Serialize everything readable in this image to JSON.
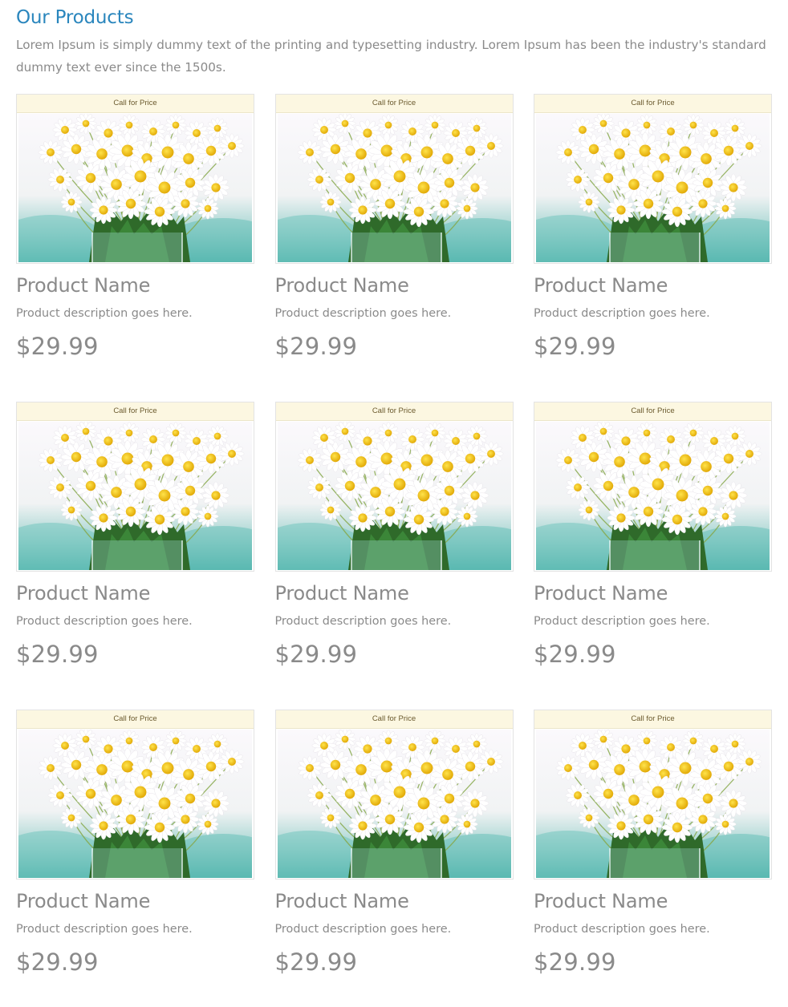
{
  "header": {
    "title": "Our Products",
    "intro": "Lorem Ipsum is simply dummy text of the printing and typesetting industry. Lorem Ipsum has been the industry's standard dummy text ever since the 1500s."
  },
  "colors": {
    "title": "#2a86bd",
    "text": "#8a8a8a",
    "banner_bg": "#fcf7e1"
  },
  "products": [
    {
      "banner": "Call for Price",
      "image": "daisy-bouquet-photo",
      "name": "Product Name",
      "description": "Product description goes here.",
      "price": "$29.99"
    },
    {
      "banner": "Call for Price",
      "image": "daisy-bouquet-photo",
      "name": "Product Name",
      "description": "Product description goes here.",
      "price": "$29.99"
    },
    {
      "banner": "Call for Price",
      "image": "daisy-bouquet-photo",
      "name": "Product Name",
      "description": "Product description goes here.",
      "price": "$29.99"
    },
    {
      "banner": "Call for Price",
      "image": "daisy-bouquet-photo",
      "name": "Product Name",
      "description": "Product description goes here.",
      "price": "$29.99"
    },
    {
      "banner": "Call for Price",
      "image": "daisy-bouquet-photo",
      "name": "Product Name",
      "description": "Product description goes here.",
      "price": "$29.99"
    },
    {
      "banner": "Call for Price",
      "image": "daisy-bouquet-photo",
      "name": "Product Name",
      "description": "Product description goes here.",
      "price": "$29.99"
    },
    {
      "banner": "Call for Price",
      "image": "daisy-bouquet-photo",
      "name": "Product Name",
      "description": "Product description goes here.",
      "price": "$29.99"
    },
    {
      "banner": "Call for Price",
      "image": "daisy-bouquet-photo",
      "name": "Product Name",
      "description": "Product description goes here.",
      "price": "$29.99"
    },
    {
      "banner": "Call for Price",
      "image": "daisy-bouquet-photo",
      "name": "Product Name",
      "description": "Product description goes here.",
      "price": "$29.99"
    }
  ]
}
